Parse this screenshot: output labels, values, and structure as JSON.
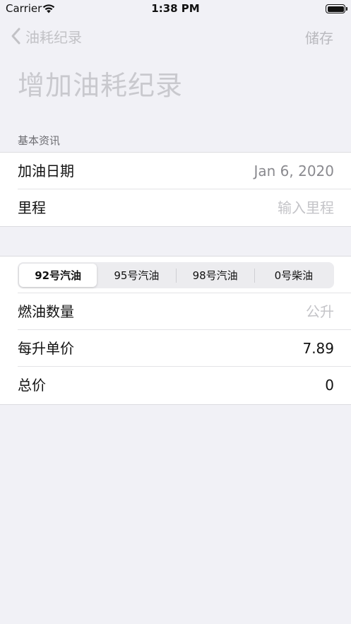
{
  "status_bar": {
    "carrier": "Carrier",
    "time": "1:38 PM",
    "wifi_icon": "wifi-icon",
    "battery_icon": "battery-icon"
  },
  "nav": {
    "back_label": "油耗纪录",
    "back_icon": "chevron-left-icon",
    "save_label": "储存"
  },
  "title": "增加油耗纪录",
  "section_basic": {
    "header": "基本资讯",
    "date_label": "加油日期",
    "date_value": "Jan 6, 2020",
    "mileage_label": "里程",
    "mileage_placeholder": "输入里程"
  },
  "fuel_types": {
    "options": [
      "92号汽油",
      "95号汽油",
      "98号汽油",
      "0号柴油"
    ],
    "selected": "92号汽油"
  },
  "section_fuel": {
    "quantity_label": "燃油数量",
    "quantity_placeholder": "公升",
    "unit_price_label": "每升单价",
    "unit_price_value": "7.89",
    "total_label": "总价",
    "total_value": "0"
  },
  "colors": {
    "background": "#f1f1f6",
    "disabled_text": "#c2c2c6"
  }
}
